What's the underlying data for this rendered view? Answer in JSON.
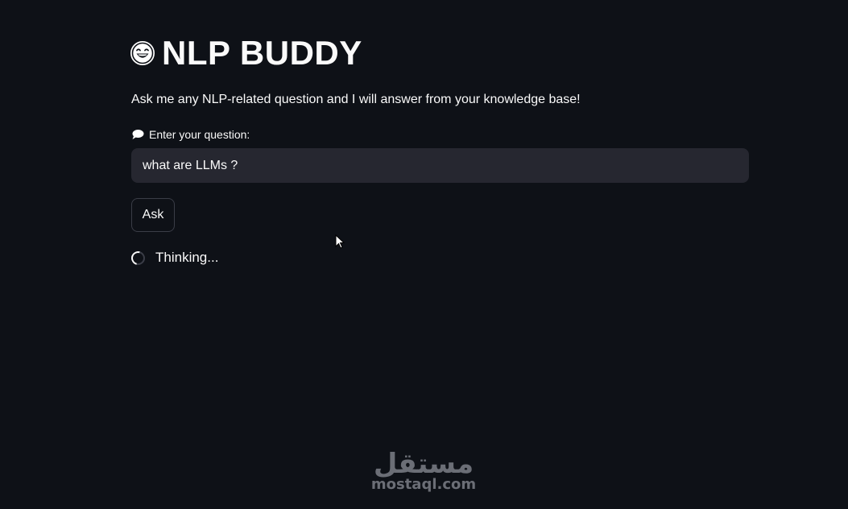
{
  "app": {
    "title": "NLP BUDDY",
    "title_icon": "grinning-face-icon",
    "subtitle": "Ask me any NLP-related question and I will answer from your knowledge base!"
  },
  "question": {
    "label": "Enter your question:",
    "label_icon": "speech-bubble-icon",
    "value": "what are LLMs ?"
  },
  "actions": {
    "ask_label": "Ask"
  },
  "status": {
    "text": "Thinking..."
  },
  "watermark": {
    "arabic": "مستقل",
    "latin": "mostaql.com"
  },
  "colors": {
    "background": "#0e1117",
    "input_background": "#262730",
    "text": "#fafafa",
    "border": "#3a3d47",
    "watermark": "#6b6e76"
  }
}
